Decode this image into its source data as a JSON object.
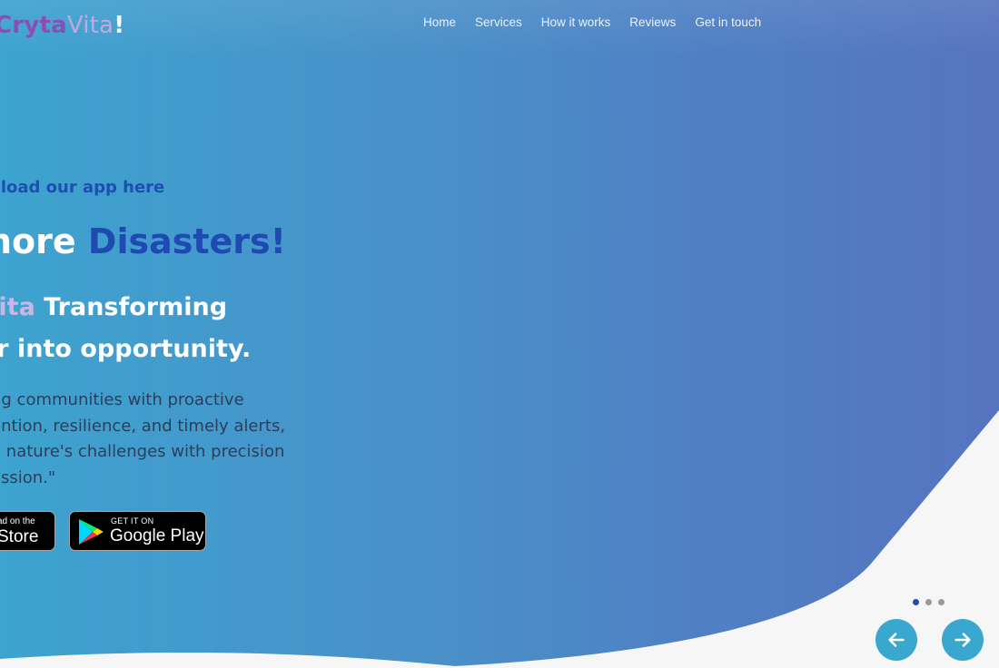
{
  "logo": {
    "part1": "Cryta",
    "part2": "Vita",
    "part3": "!"
  },
  "nav": {
    "items": [
      {
        "label": "Home"
      },
      {
        "label": "Services"
      },
      {
        "label": "How it works"
      },
      {
        "label": "Reviews"
      },
      {
        "label": "Get in touch"
      }
    ]
  },
  "hero": {
    "tagline": "nload our app here",
    "headline_plain": "nore ",
    "headline_accent": "Disasters!",
    "subhead_brand": "Vita",
    "subhead_line1_rest": " Transforming",
    "subhead_line2": "er into opportunity.",
    "description_lines": [
      "ng communities with proactive",
      "ention, resilience, and timely alerts,",
      "e nature's challenges with precision",
      "assion.\""
    ]
  },
  "store_buttons": {
    "appstore_small": "ad on the",
    "appstore_big": "Store",
    "googleplay_small": "GET IT ON",
    "googleplay_big": "Google Play"
  },
  "carousel": {
    "dots": 3,
    "active_dot": 0,
    "prev_icon": "arrow-left-icon",
    "next_icon": "arrow-right-icon"
  },
  "colors": {
    "gradient_start": "#3da3cf",
    "gradient_end": "#5674bf",
    "accent_blue": "#1f4ab2",
    "logo_purple": "#8a4fb6",
    "wave_fill": "#f6f6f7",
    "arrow_button": "#3aa7cf"
  }
}
